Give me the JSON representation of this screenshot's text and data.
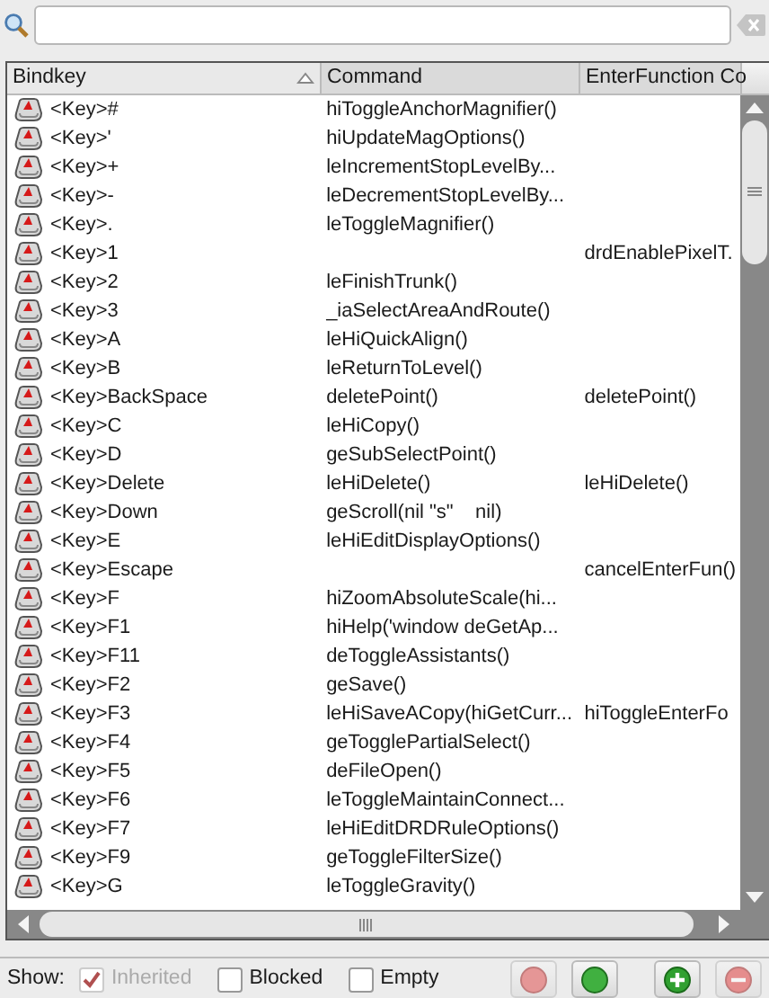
{
  "table": {
    "columns": [
      {
        "label": "Bindkey",
        "sorted": true
      },
      {
        "label": "Command",
        "sorted": false
      },
      {
        "label": "EnterFunction Co",
        "sorted": false
      }
    ],
    "rows": [
      {
        "bindkey": "<Key>#",
        "command": "hiToggleAnchorMagnifier()",
        "enter_function": ""
      },
      {
        "bindkey": "<Key>'",
        "command": "hiUpdateMagOptions()",
        "enter_function": ""
      },
      {
        "bindkey": "<Key>+",
        "command": "leIncrementStopLevelBy...",
        "enter_function": ""
      },
      {
        "bindkey": "<Key>-",
        "command": "leDecrementStopLevelBy...",
        "enter_function": ""
      },
      {
        "bindkey": "<Key>.",
        "command": "leToggleMagnifier()",
        "enter_function": ""
      },
      {
        "bindkey": "<Key>1",
        "command": "",
        "enter_function": "drdEnablePixelT."
      },
      {
        "bindkey": "<Key>2",
        "command": "leFinishTrunk()",
        "enter_function": ""
      },
      {
        "bindkey": "<Key>3",
        "command": "_iaSelectAreaAndRoute()",
        "enter_function": ""
      },
      {
        "bindkey": "<Key>A",
        "command": "leHiQuickAlign()",
        "enter_function": ""
      },
      {
        "bindkey": "<Key>B",
        "command": "leReturnToLevel()",
        "enter_function": ""
      },
      {
        "bindkey": "<Key>BackSpace",
        "command": "deletePoint()",
        "enter_function": "deletePoint()"
      },
      {
        "bindkey": "<Key>C",
        "command": "leHiCopy()",
        "enter_function": ""
      },
      {
        "bindkey": "<Key>D",
        "command": "geSubSelectPoint()",
        "enter_function": ""
      },
      {
        "bindkey": "<Key>Delete",
        "command": "leHiDelete()",
        "enter_function": "leHiDelete()"
      },
      {
        "bindkey": "<Key>Down",
        "command": "geScroll(nil \"s\"    nil)",
        "enter_function": ""
      },
      {
        "bindkey": "<Key>E",
        "command": "leHiEditDisplayOptions()",
        "enter_function": ""
      },
      {
        "bindkey": "<Key>Escape",
        "command": "",
        "enter_function": "cancelEnterFun()"
      },
      {
        "bindkey": "<Key>F",
        "command": "hiZoomAbsoluteScale(hi...",
        "enter_function": ""
      },
      {
        "bindkey": "<Key>F1",
        "command": "hiHelp('window deGetAp...",
        "enter_function": ""
      },
      {
        "bindkey": "<Key>F11",
        "command": "deToggleAssistants()",
        "enter_function": ""
      },
      {
        "bindkey": "<Key>F2",
        "command": "geSave()",
        "enter_function": ""
      },
      {
        "bindkey": "<Key>F3",
        "command": "leHiSaveACopy(hiGetCurr...",
        "enter_function": "hiToggleEnterFo"
      },
      {
        "bindkey": "<Key>F4",
        "command": "geTogglePartialSelect()",
        "enter_function": ""
      },
      {
        "bindkey": "<Key>F5",
        "command": "deFileOpen()",
        "enter_function": ""
      },
      {
        "bindkey": "<Key>F6",
        "command": "leToggleMaintainConnect...",
        "enter_function": ""
      },
      {
        "bindkey": "<Key>F7",
        "command": "leHiEditDRDRuleOptions()",
        "enter_function": ""
      },
      {
        "bindkey": "<Key>F9",
        "command": "geToggleFilterSize()",
        "enter_function": ""
      },
      {
        "bindkey": "<Key>G",
        "command": "leToggleGravity()",
        "enter_function": ""
      }
    ]
  },
  "footer": {
    "label": "Show:",
    "filters": [
      {
        "label": "Inherited",
        "checked": true,
        "disabled": true
      },
      {
        "label": "Blocked",
        "checked": false,
        "disabled": false
      },
      {
        "label": "Empty",
        "checked": false,
        "disabled": false
      }
    ],
    "buttons": [
      {
        "kind": "red-circle",
        "disabled": true
      },
      {
        "kind": "green-circle",
        "disabled": false
      },
      {
        "kind": "add",
        "disabled": false
      },
      {
        "kind": "remove",
        "disabled": true
      }
    ]
  }
}
